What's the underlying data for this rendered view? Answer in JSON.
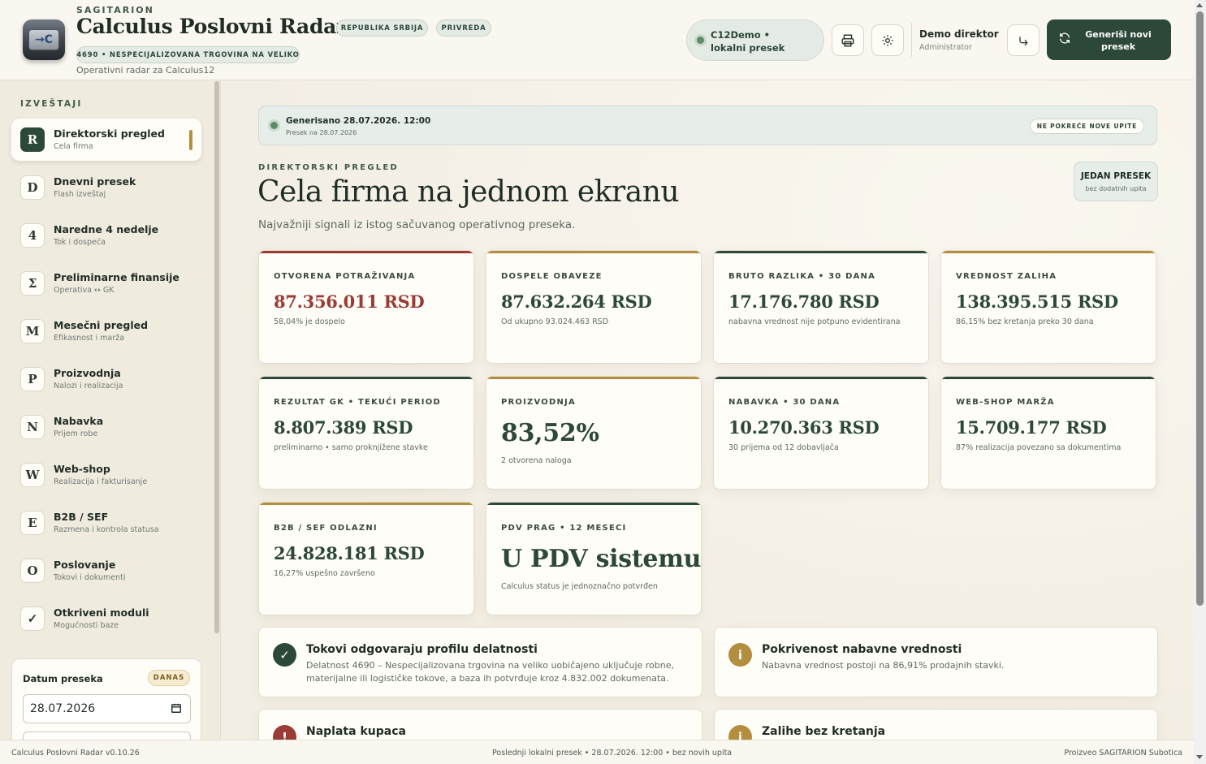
{
  "header": {
    "kicker": "SAGITARION",
    "title": "Calculus Poslovni Radar",
    "tag_country": "REPUBLIKA SRBIJA",
    "tag_sector": "PRIVREDA",
    "activity": "4690 • NESPECIJALIZOVANA TRGOVINA NA VELIKO",
    "subtitle": "Operativni radar za Calculus12",
    "connection": "C12Demo • lokalni presek",
    "user_name": "Demo direktor",
    "user_role": "Administrator",
    "generate_label": "Generiši novi presek",
    "icons": {
      "print": "printer-icon",
      "settings": "gear-icon",
      "logout": "logout-icon",
      "refresh": "refresh-icon"
    }
  },
  "sidebar": {
    "heading": "IZVEŠTAJI",
    "items": [
      {
        "badge": "R",
        "label": "Direktorski pregled",
        "sub": "Cela firma",
        "active": true
      },
      {
        "badge": "D",
        "label": "Dnevni presek",
        "sub": "Flash izveštaj"
      },
      {
        "badge": "4",
        "label": "Naredne 4 nedelje",
        "sub": "Tok i dospeća"
      },
      {
        "badge": "Σ",
        "label": "Preliminarne finansije",
        "sub": "Operativa ↔ GK"
      },
      {
        "badge": "M",
        "label": "Mesečni pregled",
        "sub": "Efikasnost i marža"
      },
      {
        "badge": "P",
        "label": "Proizvodnja",
        "sub": "Nalozi i realizacija"
      },
      {
        "badge": "N",
        "label": "Nabavka",
        "sub": "Prijem robe"
      },
      {
        "badge": "W",
        "label": "Web-shop",
        "sub": "Realizacija i fakturisanje"
      },
      {
        "badge": "E",
        "label": "B2B / SEF",
        "sub": "Razmena i kontrola statusa"
      },
      {
        "badge": "O",
        "label": "Poslovanje",
        "sub": "Tokovi i dokumenti"
      },
      {
        "badge": "✓",
        "label": "Otkriveni moduli",
        "sub": "Mogućnosti baze"
      }
    ],
    "date_label": "Datum preseka",
    "today": "DANAS",
    "date_value": "28.07.2026"
  },
  "main": {
    "generated": "Generisano 28.07.2026. 12:00",
    "snapshot_on": "Presek na 28.07.2026",
    "no_queries": "NE POKREĆE NOVE UPITE",
    "kicker": "DIREKTORSKI PREGLED",
    "title": "Cela firma na jednom ekranu",
    "subtitle": "Najvažniji signali iz istog sačuvanog operativnog preseka.",
    "one_snapshot": "JEDAN PRESEK",
    "one_snapshot_sub": "bez dodatnih upita",
    "kpis": [
      {
        "label": "OTVORENA POTRAŽIVANJA",
        "value": "87.356.011 RSD",
        "note": "58,04% je dospelo",
        "accent": "#9a3b35",
        "value_color": "#9a3b35"
      },
      {
        "label": "DOSPELE OBAVEZE",
        "value": "87.632.264 RSD",
        "note": "Od ukupno 93.024.463 RSD",
        "accent": "#b38e3e",
        "value_color": "#2c4839"
      },
      {
        "label": "BRUTO RAZLIKA • 30 DANA",
        "value": "17.176.780 RSD",
        "note": "nabavna vrednost nije potpuno evidentirana",
        "accent": "#2c4839",
        "value_color": "#2c4839"
      },
      {
        "label": "VREDNOST ZALIHA",
        "value": "138.395.515 RSD",
        "note": "86,15% bez kretanja preko 30 dana",
        "accent": "#b38e3e",
        "value_color": "#2c4839"
      },
      {
        "label": "REZULTAT GK • TEKUĆI PERIOD",
        "value": "8.807.389 RSD",
        "note": "preliminarno • samo proknjižene stavke",
        "accent": "#2c4839",
        "value_color": "#2c4839"
      },
      {
        "label": "PROIZVODNJA",
        "value": "83,52%",
        "note": "2 otvorena naloga",
        "accent": "#b38e3e",
        "value_color": "#2c4839",
        "big": true
      },
      {
        "label": "NABAVKA • 30 DANA",
        "value": "10.270.363 RSD",
        "note": "30 prijema od 12 dobavljača",
        "accent": "#2c4839",
        "value_color": "#2c4839"
      },
      {
        "label": "WEB-SHOP MARŽA",
        "value": "15.709.177 RSD",
        "note": "87% realizacija povezano sa dokumentima",
        "accent": "#2c4839",
        "value_color": "#2c4839"
      },
      {
        "label": "B2B / SEF ODLAZNI",
        "value": "24.828.181 RSD",
        "note": "16,27% uspešno završeno",
        "accent": "#b38e3e",
        "value_color": "#2c4839"
      },
      {
        "label": "PDV PRAG • 12 MESECI",
        "value": "U PDV sistemu",
        "note": "Calculus status je jednoznačno potvrđen",
        "accent": "#2c4839",
        "value_color": "#2c4839",
        "big": true
      }
    ],
    "signals": [
      {
        "icon": "✓",
        "icon_name": "check-icon",
        "color": "#2c4839",
        "title": "Tokovi odgovaraju profilu delatnosti",
        "text": "Delatnost 4690 – Nespecijalizovana trgovina na veliko uobičajeno uključuje robne, materijalne ili logističke tokove, a baza ih potvrđuje kroz 4.832.002 dokumenata."
      },
      {
        "icon": "i",
        "icon_name": "info-icon",
        "color": "#b38e3e",
        "title": "Pokrivenost nabavne vrednosti",
        "text": "Nabavna vrednost postoji na 86,91% prodajnih stavki."
      },
      {
        "icon": "!",
        "icon_name": "alert-icon",
        "color": "#9a3b35",
        "title": "Naplata kupaca",
        "text": ""
      },
      {
        "icon": "i",
        "icon_name": "info-icon",
        "color": "#b38e3e",
        "title": "Zalihe bez kretanja",
        "text": ""
      }
    ]
  },
  "footer": {
    "version": "Calculus Poslovni Radar v0.10.26",
    "last": "Poslednji lokalni presek • 28.07.2026. 12:00 • bez novih upita",
    "made_by": "Proizveo SAGITARION Subotica"
  }
}
